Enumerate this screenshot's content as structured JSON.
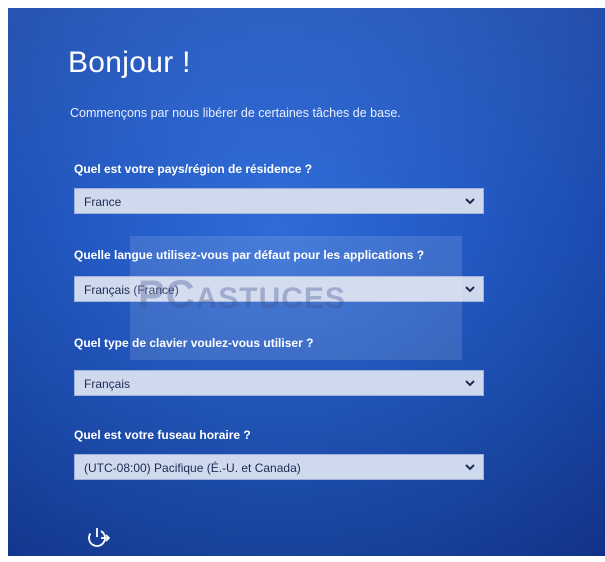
{
  "setup": {
    "title": "Bonjour !",
    "subtitle": "Commençons par nous libérer de certaines tâches de base.",
    "fields": [
      {
        "label": "Quel est votre pays/région de résidence ?",
        "value": "France"
      },
      {
        "label": "Quelle langue utilisez-vous par défaut pour les applications ?",
        "value": "Français (France)"
      },
      {
        "label": "Quel type de clavier voulez-vous utiliser ?",
        "value": "Français"
      },
      {
        "label": "Quel est votre fuseau horaire ?",
        "value": "(UTC-08:00) Pacifique (É.-U. et Canada)"
      }
    ]
  },
  "watermark": {
    "text_main": "PC",
    "text_rest": "ASTUCES"
  },
  "icons": {
    "power": "ease-of-access-icon",
    "chevron": "chevron-down-icon"
  },
  "colors": {
    "background": "#245cc6",
    "field": "#cfd9ee"
  }
}
